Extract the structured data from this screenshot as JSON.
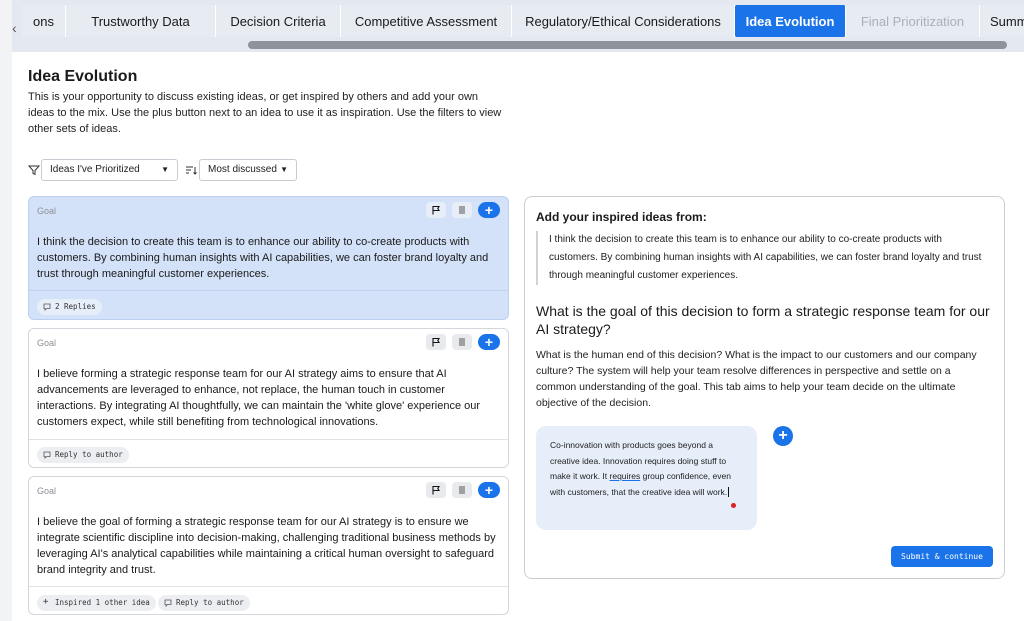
{
  "tabs": [
    {
      "label": "ons",
      "state": "normal"
    },
    {
      "label": "Trustworthy Data",
      "state": "normal"
    },
    {
      "label": "Decision Criteria",
      "state": "normal"
    },
    {
      "label": "Competitive Assessment",
      "state": "normal"
    },
    {
      "label": "Regulatory/Ethical Considerations",
      "state": "normal"
    },
    {
      "label": "Idea Evolution",
      "state": "active"
    },
    {
      "label": "Final Prioritization",
      "state": "disabled"
    },
    {
      "label": "Summary",
      "state": "normal"
    }
  ],
  "page": {
    "title": "Idea Evolution",
    "intro": "This is your opportunity to discuss existing ideas, or get inspired by others and add your own ideas to the mix. Use the plus button next to an idea to use it as inspiration. Use the filters to view other sets of ideas."
  },
  "filters": {
    "filter_value": "Ideas I've Prioritized",
    "sort_value": "Most discussed"
  },
  "ideas": [
    {
      "label": "Goal",
      "text": "I think the decision to create this team is to enhance our ability to co-create products with customers. By combining human insights with AI capabilities, we can foster brand loyalty and trust through meaningful customer experiences.",
      "chips": [
        "2 Replies"
      ],
      "selected": true
    },
    {
      "label": "Goal",
      "text": "I believe forming a strategic response team for our AI strategy aims to ensure that AI advancements are leveraged to enhance, not replace, the human touch in customer interactions. By integrating AI thoughtfully, we can maintain the 'white glove' experience our customers expect, while still benefiting from technological innovations.",
      "chips": [
        "Reply to author"
      ],
      "selected": false
    },
    {
      "label": "Goal",
      "text": "I believe the goal of forming a strategic response team for our AI strategy is to ensure we integrate scientific discipline into decision-making, challenging traditional business methods by leveraging AI's analytical capabilities while maintaining a critical human oversight to safeguard brand integrity and trust.",
      "chips": [
        "Inspired 1 other idea",
        "Reply to author"
      ],
      "selected": false
    }
  ],
  "panel": {
    "heading": "Add your inspired ideas from:",
    "quote": "I think the decision to create this team is to enhance our ability to co-create products with customers. By combining human insights with AI capabilities, we can foster brand loyalty and trust through meaningful customer experiences.",
    "question": "What is the goal of this decision to form a strategic response team for our AI strategy?",
    "description": "What is the human end of this decision? What is the impact to our customers and our company culture? The system will help your team resolve differences in perspective and settle on a common understanding of the goal. This tab aims to help your team decide on the ultimate objective of the decision.",
    "answer_before": "Co-innovation with products goes beyond a creative idea. Innovation requires doing stuff to make it work. It ",
    "answer_flagged": "requires",
    "answer_after": " group confidence, even with customers, that the creative idea will work.",
    "submit_label": "Submit & continue"
  },
  "colors": {
    "accent": "#1a73e8",
    "selected_card": "#d3e2f8",
    "answer_bubble": "#e6eef9"
  }
}
